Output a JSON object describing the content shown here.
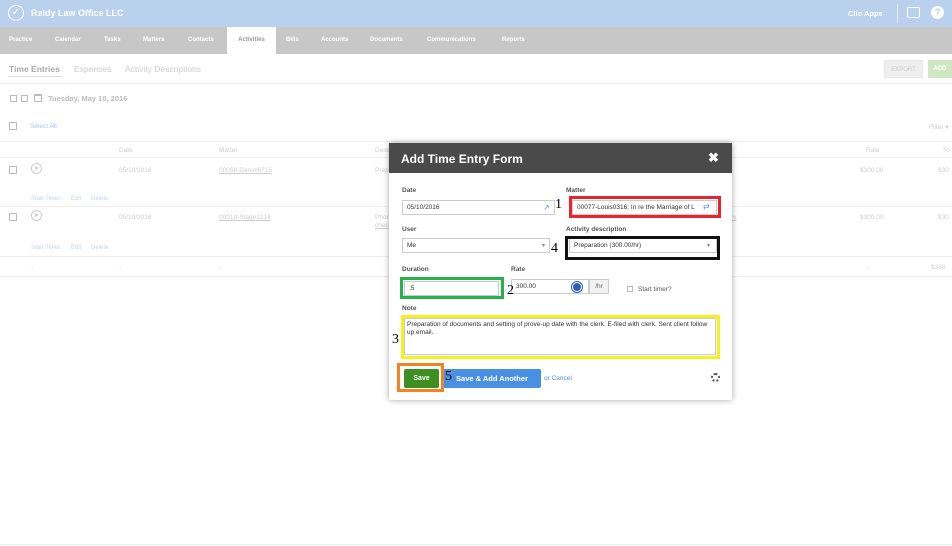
{
  "app": {
    "firm_name": "Reidy Law Office LLC",
    "clio_apps": "Clio Apps"
  },
  "nav": [
    "Practice",
    "Calendar",
    "Tasks",
    "Matters",
    "Contacts",
    "Activities",
    "Bills",
    "Accounts",
    "Documents",
    "Communications",
    "Reports"
  ],
  "subtabs": [
    "Time Entries",
    "Expenses",
    "Activity Descriptions"
  ],
  "buttons": {
    "export": "EXPORT",
    "add": "ADD"
  },
  "date_heading": "Tuesday, May 10, 2016",
  "select_all": "Select All",
  "filter": "Filter ▾",
  "table": {
    "headers": {
      "date": "Date",
      "matter": "Matter",
      "desc": "Desc",
      "rate": "Rate",
      "total": "To"
    },
    "rows": [
      {
        "date": "05/10/2016",
        "matter": "00058-Daniel6715",
        "desc": "Prep",
        "rate": "$300.00",
        "total": "$30"
      },
      {
        "date": "05/10/2016",
        "matter": "00018-Stage1214",
        "desc": "Phon",
        "desc2": "chec",
        "extra": "ry",
        "rate": "$300.00",
        "total": "$30"
      }
    ],
    "row_actions": [
      "Start Timer",
      "Edit",
      "Delete"
    ],
    "summary": {
      "col1": "-",
      "col2": "-",
      "col3": "-",
      "col4": "-",
      "total": "$330"
    }
  },
  "modal": {
    "title": "Add Time Entry Form",
    "date_label": "Date",
    "date_value": "05/10/2016",
    "matter_label": "Matter",
    "matter_value": "00077-Louis0316: In re the Marriage of L",
    "user_label": "User",
    "user_value": "Me",
    "activity_label": "Activity description",
    "activity_value": "Preparation (300.00/hr)",
    "duration_label": "Duration",
    "duration_value": ".5",
    "rate_label": "Rate",
    "rate_value": "300.00",
    "rate_unit": "/hr",
    "start_timer": "Start timer?",
    "note_label": "Note",
    "note_value": "Preparation of documents and setting of prove-up date with the clerk. E-filed with clerk. Sent client follow up email.",
    "save": "Save",
    "save_add": "Save & Add Another",
    "cancel": "or Cancel"
  },
  "annotations": [
    "1",
    "2",
    "3",
    "4",
    "5"
  ],
  "colors": {
    "top_bar": "#b9d1ec",
    "nav_bar": "#c7c7c7",
    "modal_header": "#4a4a4a",
    "save": "#3e8e23",
    "save_add": "#4a90e2",
    "hl_red": "#e8242f",
    "hl_green": "#25b24a",
    "hl_yellow": "#f6f01e",
    "hl_black": "#111111",
    "hl_orange": "#f58220"
  }
}
